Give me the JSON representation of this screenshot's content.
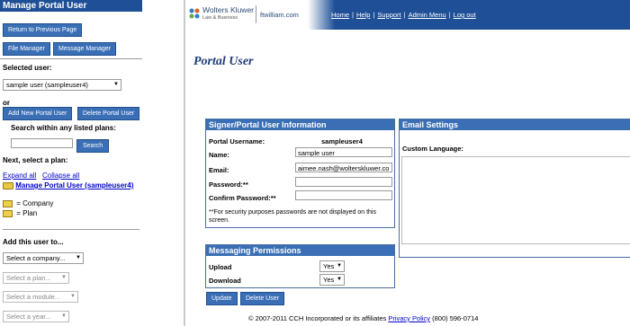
{
  "sidebar": {
    "title": "Manage Portal User",
    "return_button": "Return to Previous Page",
    "file_manager_button": "File Manager",
    "message_manager_button": "Message Manager",
    "selected_user_label": "Selected user:",
    "selected_user_value": "sample user (sampleuser4)",
    "or_label": "or",
    "add_user_button": "Add New Portal User",
    "delete_user_button": "Delete Portal User",
    "search_label": "Search within any listed plans:",
    "search_value": "",
    "search_button": "Search",
    "next_label": "Next, select a plan:",
    "expand_all": "Expand all",
    "collapse_all": "Collapse all",
    "tree_root": "Manage Portal User (sampleuser4)",
    "legend_company": "= Company",
    "legend_plan": "= Plan",
    "add_user_to_label": "Add this user to...",
    "select_company": "Select a company...",
    "select_plan": "Select a plan...",
    "select_module": "Select a module...",
    "select_year": "Select a year..."
  },
  "header": {
    "brand": "Wolters Kluwer",
    "brand_sub": "Law & Business",
    "product": "ftwilliam.com",
    "nav": [
      "Home",
      "Help",
      "Support",
      "Admin Menu",
      "Log out"
    ]
  },
  "main": {
    "page_title": "Portal User",
    "signer_panel": {
      "title": "Signer/Portal User Information",
      "username_label": "Portal Username:",
      "username_value": "sampleuser4",
      "name_label": "Name:",
      "name_value": "sample user",
      "email_label": "Email:",
      "email_value": "aimee.nash@wolterskluwer.co",
      "password_label": "Password:**",
      "confirm_label": "Confirm Password:**",
      "note": "**For security purposes passwords are not displayed on this screen."
    },
    "email_panel": {
      "title": "Email Settings",
      "custom_language_label": "Custom Language:"
    },
    "messaging_panel": {
      "title": "Messaging Permissions",
      "upload_label": "Upload",
      "upload_value": "Yes",
      "download_label": "Download",
      "download_value": "Yes"
    },
    "update_button": "Update",
    "delete_user_button": "Delete User"
  },
  "footer": {
    "copyright": "© 2007-2011 CCH Incorporated or its affiliates",
    "privacy_link": "Privacy Policy",
    "phone": "(800) 596-0714"
  },
  "colors": {
    "header_blue": "#1f4f97",
    "button_blue": "#3a6fb5",
    "title_navy": "#1f3d7a",
    "link_blue": "#0000cc"
  }
}
